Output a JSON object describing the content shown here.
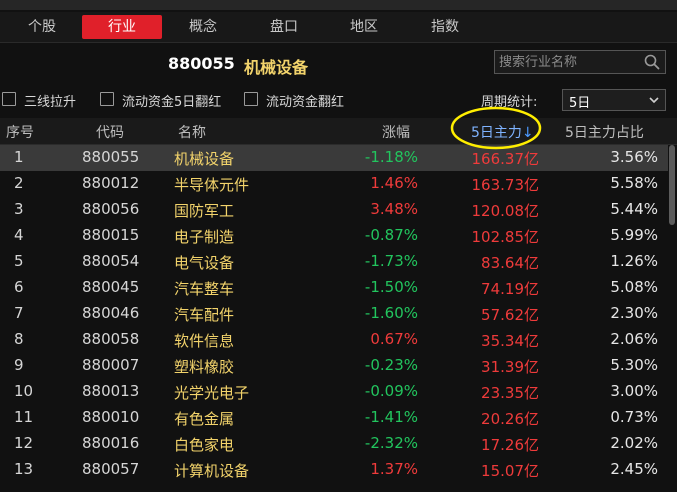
{
  "tabs": [
    {
      "label": "个股"
    },
    {
      "label": "行业"
    },
    {
      "label": "概念"
    },
    {
      "label": "盘口"
    },
    {
      "label": "地区"
    },
    {
      "label": "指数"
    }
  ],
  "active_tab": "行业",
  "header": {
    "code": "880055",
    "name": "机械设备",
    "search_placeholder": "搜索行业名称",
    "search_icon": "search-icon"
  },
  "filters": {
    "checkboxes": [
      {
        "label": "三线拉升",
        "checked": false
      },
      {
        "label": "流动资金5日翻红",
        "checked": false
      },
      {
        "label": "流动资金翻红",
        "checked": false
      }
    ],
    "period_label": "周期统计:",
    "period_value": "5日"
  },
  "table": {
    "headers": {
      "idx": "序号",
      "code": "代码",
      "name": "名称",
      "change": "涨幅",
      "main": "5日主力",
      "sort_indicator": "↓",
      "ratio": "5日主力占比"
    },
    "rows": [
      {
        "idx": "1",
        "code": "880055",
        "name": "机械设备",
        "change": "-1.18%",
        "main": "166.37亿",
        "ratio": "3.56%"
      },
      {
        "idx": "2",
        "code": "880012",
        "name": "半导体元件",
        "change": "1.46%",
        "main": "163.73亿",
        "ratio": "5.58%"
      },
      {
        "idx": "3",
        "code": "880056",
        "name": "国防军工",
        "change": "3.48%",
        "main": "120.08亿",
        "ratio": "5.44%"
      },
      {
        "idx": "4",
        "code": "880015",
        "name": "电子制造",
        "change": "-0.87%",
        "main": "102.85亿",
        "ratio": "5.99%"
      },
      {
        "idx": "5",
        "code": "880054",
        "name": "电气设备",
        "change": "-1.73%",
        "main": "83.64亿",
        "ratio": "1.26%"
      },
      {
        "idx": "6",
        "code": "880045",
        "name": "汽车整车",
        "change": "-1.50%",
        "main": "74.19亿",
        "ratio": "5.08%"
      },
      {
        "idx": "7",
        "code": "880046",
        "name": "汽车配件",
        "change": "-1.60%",
        "main": "57.62亿",
        "ratio": "2.30%"
      },
      {
        "idx": "8",
        "code": "880058",
        "name": "软件信息",
        "change": "0.67%",
        "main": "35.34亿",
        "ratio": "2.06%"
      },
      {
        "idx": "9",
        "code": "880007",
        "name": "塑料橡胶",
        "change": "-0.23%",
        "main": "31.39亿",
        "ratio": "5.30%"
      },
      {
        "idx": "10",
        "code": "880013",
        "name": "光学光电子",
        "change": "-0.09%",
        "main": "23.35亿",
        "ratio": "3.00%"
      },
      {
        "idx": "11",
        "code": "880010",
        "name": "有色金属",
        "change": "-1.41%",
        "main": "20.26亿",
        "ratio": "0.73%"
      },
      {
        "idx": "12",
        "code": "880016",
        "name": "白色家电",
        "change": "-2.32%",
        "main": "17.26亿",
        "ratio": "2.02%"
      },
      {
        "idx": "13",
        "code": "880057",
        "name": "计算机设备",
        "change": "1.37%",
        "main": "15.07亿",
        "ratio": "2.45%"
      }
    ]
  },
  "colors": {
    "accent": "#e0202a",
    "up": "#ef3b3b",
    "down": "#22c55e",
    "name": "#f2d36b",
    "annotation": "#ffee00"
  }
}
